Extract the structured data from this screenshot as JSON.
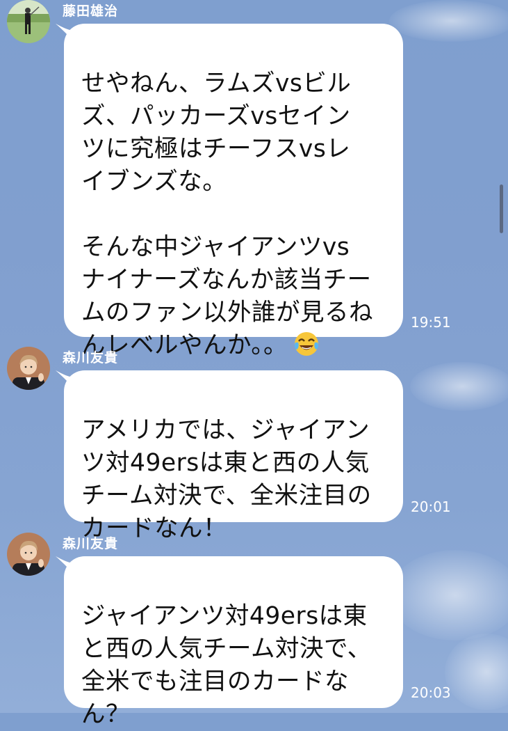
{
  "messages": [
    {
      "sender": "藤田雄治",
      "text": "せやねん、ラムズvsビル\nズ、パッカーズvsセイン\nツに究極はチーフスvsレ\nイブンズな。\n\nそんな中ジャイアンツvs\nナイナーズなんか該当チー\nムのファン以外誰が見るね\nんレベルやんか。。",
      "emoji": "tears-of-joy-emoji",
      "time": "19:51"
    },
    {
      "sender": "森川友貴",
      "text": "アメリカでは、ジャイアン\nツ対49ersは東と西の人気\nチーム対決で、全米注目の\nカードなん！",
      "time": "20:01"
    },
    {
      "sender": "森川友貴",
      "text": "ジャイアンツ対49ersは東\nと西の人気チーム対決で、\n全米でも注目のカードな\nん？",
      "time": "20:03"
    }
  ],
  "colors": {
    "background": "#819fcf",
    "bubble": "#ffffff",
    "text": "#111111",
    "meta_text": "#ffffff"
  }
}
